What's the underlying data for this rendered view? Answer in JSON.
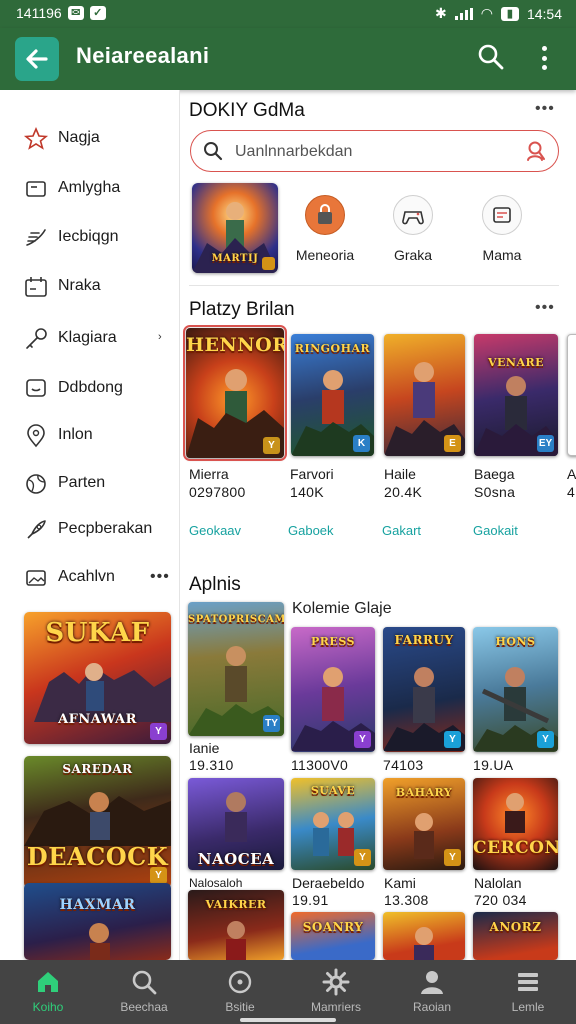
{
  "status_bar": {
    "time_left": "141196",
    "time_right": "14:54"
  },
  "app_bar": {
    "title": "Neiareealani"
  },
  "sidebar": {
    "items": [
      {
        "label": "Nagja",
        "icon": "star-icon"
      },
      {
        "label": "Amlygha",
        "icon": "tablet-icon"
      },
      {
        "label": "Iecbiqgn",
        "icon": "feather-icon"
      },
      {
        "label": "Nraka",
        "icon": "calendar-icon"
      },
      {
        "label": "Klagiara",
        "icon": "key-icon"
      },
      {
        "label": "Ddbdong",
        "icon": "chat-icon"
      },
      {
        "label": "Inlon",
        "icon": "location-icon"
      },
      {
        "label": "Parten",
        "icon": "globe-icon"
      },
      {
        "label": "Pecpberakan",
        "icon": "rocket-icon"
      },
      {
        "label": "Acahlvn",
        "icon": "image-icon"
      }
    ],
    "posters": [
      {
        "title": "SUKAF",
        "subtitle": "AFNAWAR"
      },
      {
        "title": "SAREDAR",
        "subtitle": "DEACOCK"
      },
      {
        "title": "HAXMAR",
        "subtitle": ""
      }
    ]
  },
  "sections": {
    "top": {
      "title": "DOKIY GdMa"
    },
    "popular": {
      "title": "Platzy Brilan"
    },
    "apps": {
      "title": "Aplnis",
      "subtitle": "Kolemie Glaje"
    }
  },
  "search": {
    "placeholder": "Uanlnnarbekdan"
  },
  "featured": {
    "poster_text": "MARTIJ"
  },
  "categories": [
    {
      "label": "Meneoria",
      "icon": "bag-icon"
    },
    {
      "label": "Graka",
      "icon": "controller-icon"
    },
    {
      "label": "Mama",
      "icon": "store-icon"
    }
  ],
  "popular_games": [
    {
      "name": "Mierra",
      "count": "0297800",
      "link": "Geokaav",
      "poster": "HENNOR",
      "badge": "Y",
      "badge_color": "#c8921a"
    },
    {
      "name": "Farvori",
      "count": "140K",
      "link": "Gaboek",
      "poster": "RINGOHAR",
      "badge": "K",
      "badge_color": "#2a7fc6"
    },
    {
      "name": "Haile",
      "count": "20.4K",
      "link": "Gakart",
      "poster": "",
      "badge": "E",
      "badge_color": "#d49316"
    },
    {
      "name": "Baega",
      "count": "S0sna",
      "link": "Gaokait",
      "poster": "VENARE",
      "badge": "EY",
      "badge_color": "#2a7fc6"
    },
    {
      "name": "A",
      "count": "4",
      "link": "",
      "poster": "",
      "badge": "",
      "badge_color": "#ffffff"
    }
  ],
  "app_games": [
    {
      "name": "Ianie",
      "count": "19.310",
      "poster": "SPATOPRISCAM",
      "badge": "TY",
      "badge_color": "#2a7fc6"
    },
    {
      "name": "",
      "count": "11300V0",
      "poster": "PRESS",
      "badge": "Y",
      "badge_color": "#8a3fd0"
    },
    {
      "name": "",
      "count": "74103",
      "poster": "FARRUY",
      "badge": "Y",
      "badge_color": "#1aa0d8"
    },
    {
      "name": "",
      "count": "19.UA",
      "poster": "HONS",
      "badge": "Y",
      "badge_color": "#1aa0d8"
    },
    {
      "name": "",
      "count": "",
      "poster": "NAOCEA",
      "badge": "",
      "badge_color": "#ffffff"
    },
    {
      "name": "Deraebeldo",
      "count": "19.91",
      "poster": "SUAVE",
      "badge": "Y",
      "badge_color": "#d49316"
    },
    {
      "name": "Kami",
      "count": "13.308",
      "poster": "BAHARY",
      "badge": "Y",
      "badge_color": "#d49316"
    },
    {
      "name": "Nalolan",
      "count": "720 034",
      "poster": "CERCON",
      "badge": "",
      "badge_color": "#ffffff"
    },
    {
      "name": "Nalosaloh",
      "count": "",
      "poster": "VAIKRER",
      "badge": "",
      "badge_color": "#ffffff"
    },
    {
      "name": "",
      "count": "",
      "poster": "SOANRY",
      "badge": "",
      "badge_color": "#ffffff"
    },
    {
      "name": "",
      "count": "",
      "poster": "",
      "badge": "",
      "badge_color": "#ffffff"
    },
    {
      "name": "",
      "count": "",
      "poster": "ANORZ",
      "badge": "",
      "badge_color": "#ffffff"
    }
  ],
  "bottom_nav": [
    {
      "label": "Koiho",
      "icon": "home-icon",
      "active": true
    },
    {
      "label": "Beechaa",
      "icon": "search-icon",
      "active": false
    },
    {
      "label": "Bsitie",
      "icon": "compass-icon",
      "active": false
    },
    {
      "label": "Mamriers",
      "icon": "settings-icon",
      "active": false
    },
    {
      "label": "Raoian",
      "icon": "profile-icon",
      "active": false
    },
    {
      "label": "Lemle",
      "icon": "menu-icon",
      "active": false
    }
  ],
  "colors": {
    "app_bar": "#2e6b3a",
    "accent_teal": "#2aa58a",
    "link": "#17a2a0",
    "search_border": "#d9534f",
    "nav_active": "#2fcf7a",
    "nav_bg": "#444444"
  }
}
